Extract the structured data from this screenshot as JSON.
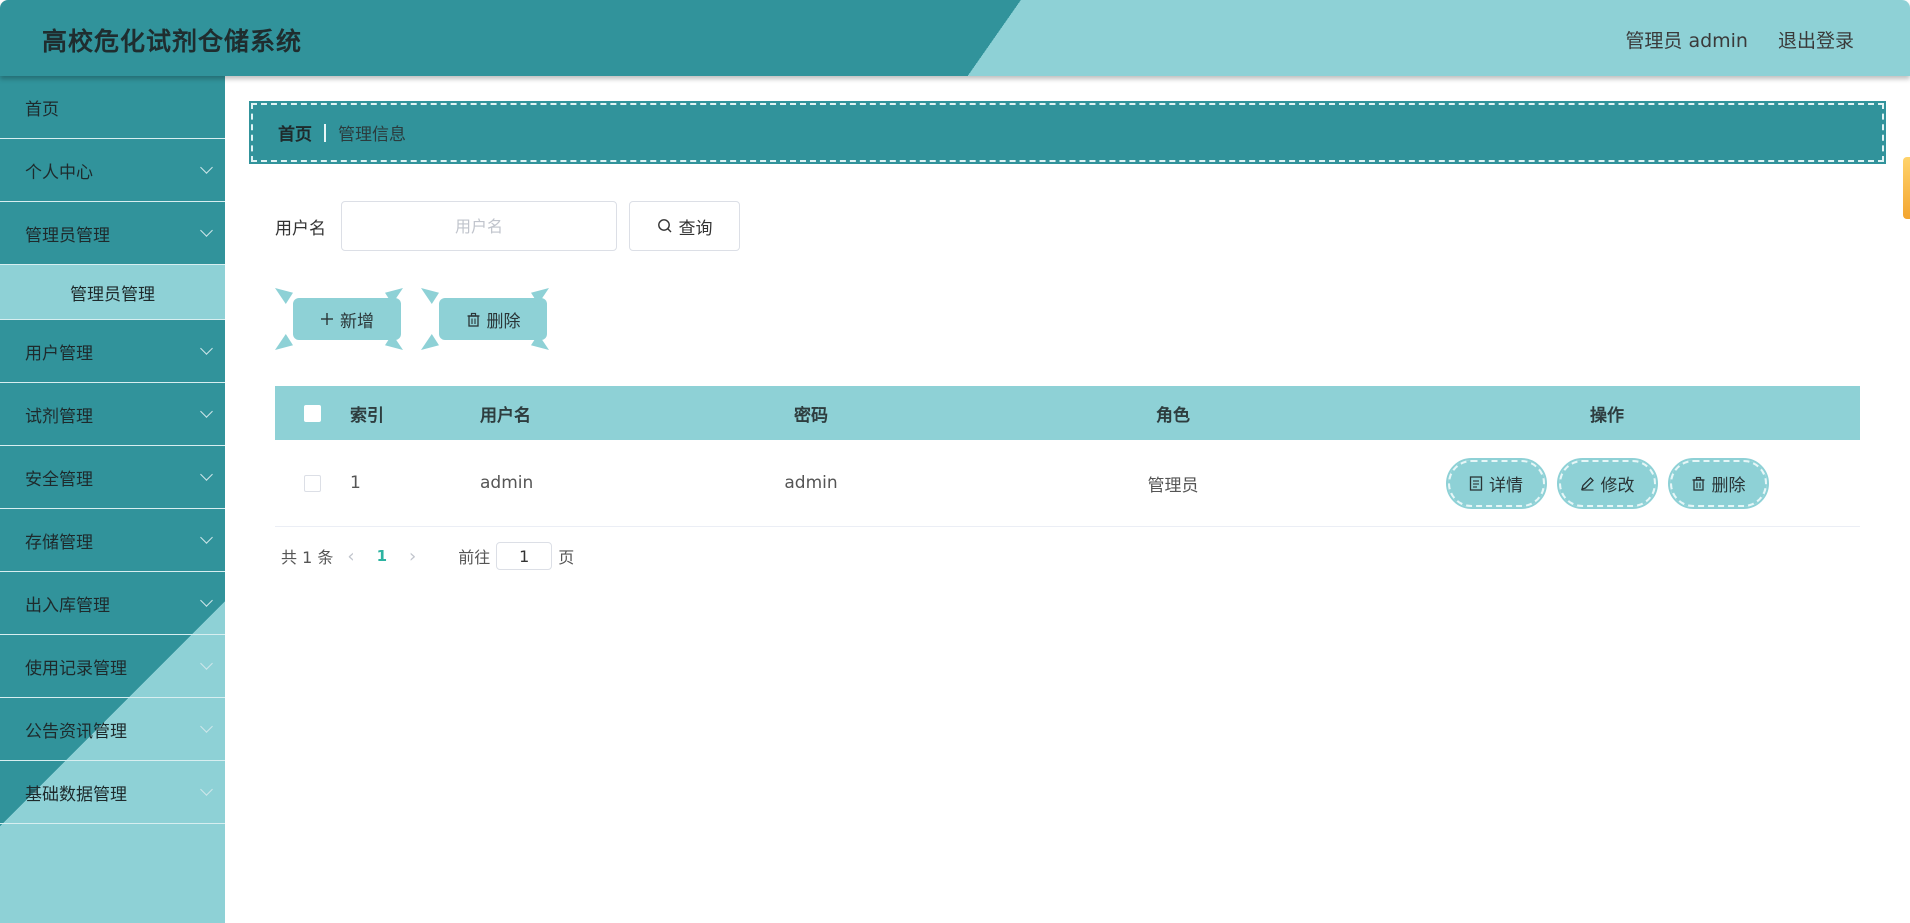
{
  "header": {
    "title": "高校危化试剂仓储系统",
    "user_label": "管理员 admin",
    "logout_label": "退出登录"
  },
  "sidebar": {
    "items": [
      {
        "label": "首页",
        "has_arrow": false
      },
      {
        "label": "个人中心",
        "has_arrow": true
      },
      {
        "label": "管理员管理",
        "has_arrow": true
      },
      {
        "label": "管理员管理",
        "sub": true
      },
      {
        "label": "用户管理",
        "has_arrow": true
      },
      {
        "label": "试剂管理",
        "has_arrow": true
      },
      {
        "label": "安全管理",
        "has_arrow": true
      },
      {
        "label": "存储管理",
        "has_arrow": true
      },
      {
        "label": "出入库管理",
        "has_arrow": true
      },
      {
        "label": "使用记录管理",
        "has_arrow": true
      },
      {
        "label": "公告资讯管理",
        "has_arrow": true
      },
      {
        "label": "基础数据管理",
        "has_arrow": true
      }
    ]
  },
  "breadcrumb": {
    "home": "首页",
    "current": "管理信息"
  },
  "search": {
    "label": "用户名",
    "placeholder": "用户名",
    "query_label": "查询"
  },
  "actions": {
    "add_label": "新增",
    "delete_label": "删除"
  },
  "table": {
    "headers": {
      "index": "索引",
      "username": "用户名",
      "password": "密码",
      "role": "角色",
      "operation": "操作"
    },
    "rows": [
      {
        "index": "1",
        "username": "admin",
        "password": "admin",
        "role": "管理员"
      }
    ],
    "row_actions": {
      "detail": "详情",
      "edit": "修改",
      "delete": "删除"
    }
  },
  "pagination": {
    "total": "共 1 条",
    "current_page": "1",
    "goto_label": "前往",
    "goto_value": "1",
    "page_suffix": "页"
  },
  "colors": {
    "primary": "#31939b",
    "light": "#8ed1d6"
  }
}
